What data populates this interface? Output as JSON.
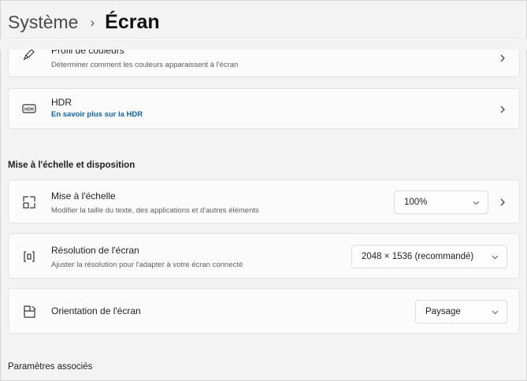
{
  "breadcrumb": {
    "parent": "Système",
    "separator": "›",
    "current": "Écran"
  },
  "cards": {
    "color_profile": {
      "title": "Profil de couleurs",
      "subtitle": "Déterminer comment les couleurs apparaissent à l'écran",
      "icon": "pen-icon"
    },
    "hdr": {
      "title": "HDR",
      "link": "En savoir plus sur la HDR",
      "icon": "hdr-icon"
    }
  },
  "section_scale": "Mise à l'échelle et disposition",
  "scale": {
    "title": "Mise à l'échelle",
    "subtitle": "Modifier la taille du texte, des applications et d'autres éléments",
    "value": "100%",
    "icon": "scale-icon"
  },
  "resolution": {
    "title": "Résolution de l'écran",
    "subtitle": "Ajuster la résolution pour l'adapter à  votre  écran connecté",
    "value": "2048 × 1536 (recommandé)",
    "icon": "resolution-icon"
  },
  "orientation": {
    "title": "Orientation de l'écran",
    "value": "Paysage",
    "icon": "orientation-icon"
  },
  "section_related": "Paramètres associés"
}
